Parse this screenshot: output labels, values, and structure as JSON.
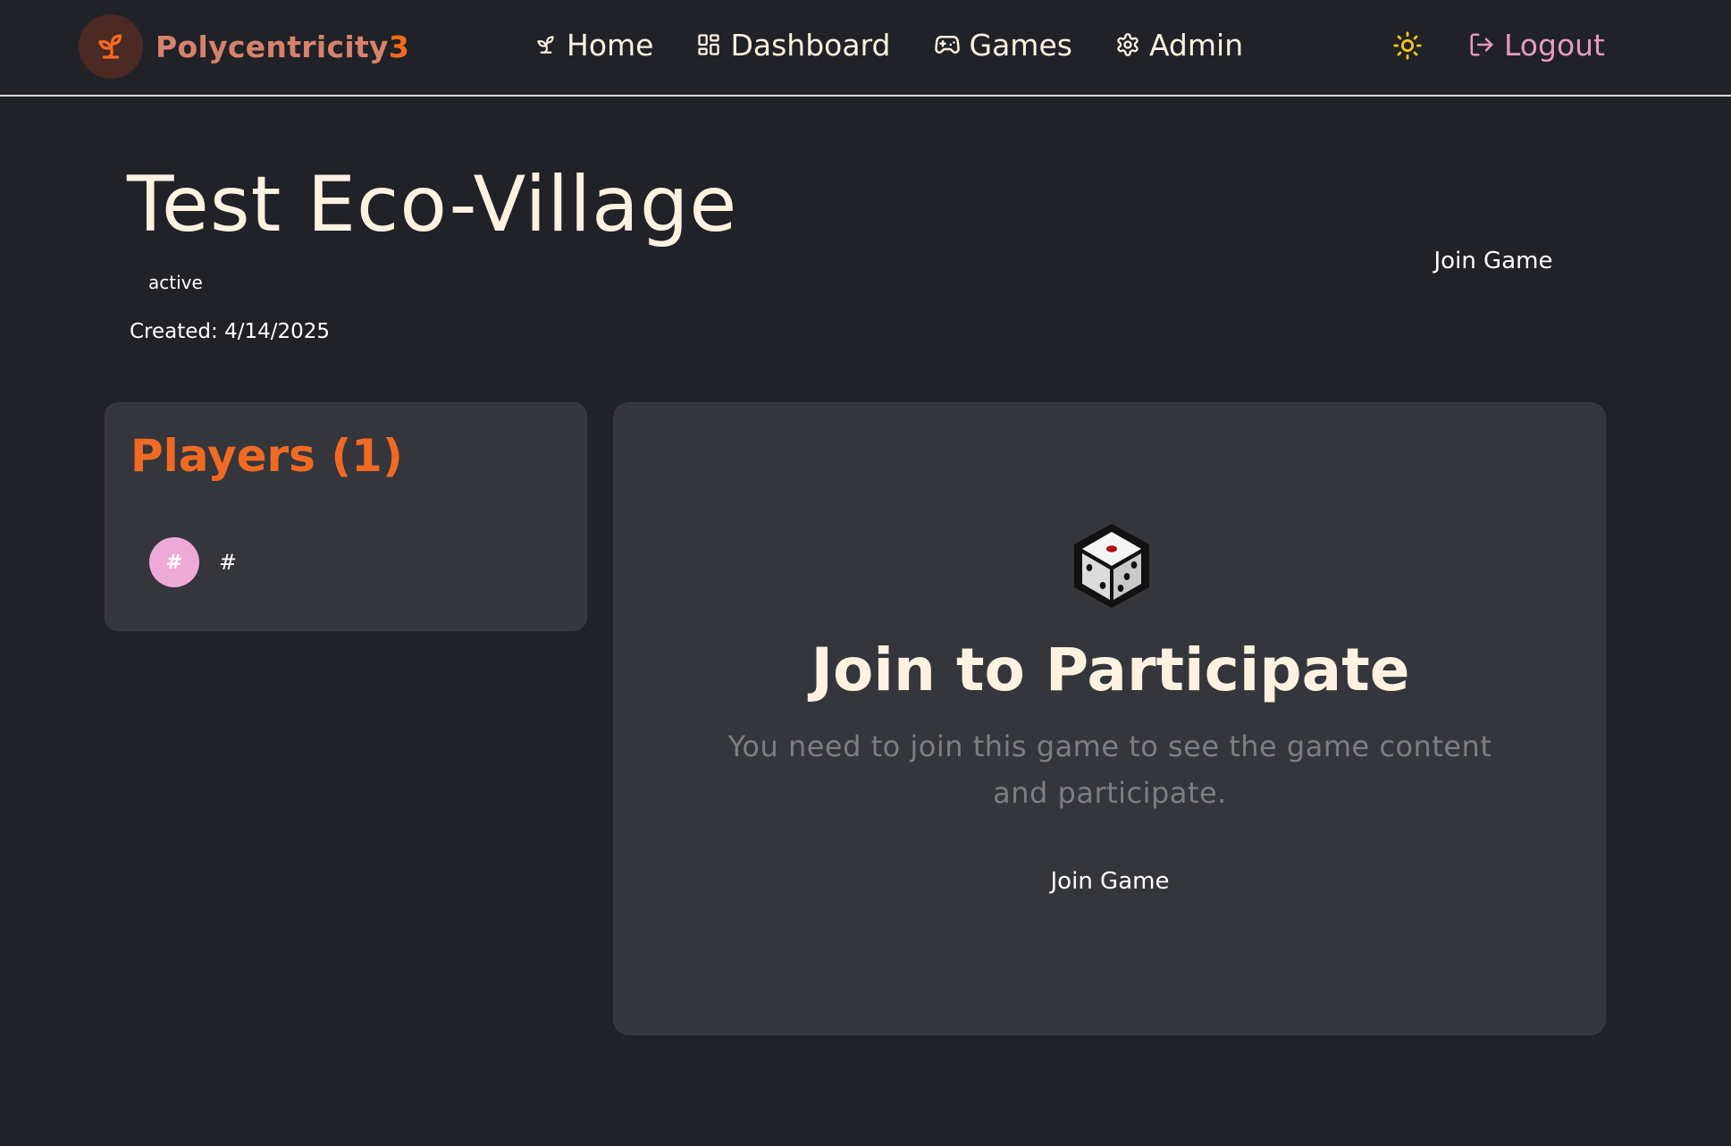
{
  "nav": {
    "brand_name": "Polycentricity",
    "brand_suffix": "3",
    "links": [
      {
        "label": "Home",
        "icon": "sprout-icon"
      },
      {
        "label": "Dashboard",
        "icon": "grid-icon"
      },
      {
        "label": "Games",
        "icon": "gamepad-icon"
      },
      {
        "label": "Admin",
        "icon": "gear-icon"
      }
    ],
    "theme_icon": "sun-icon",
    "logout_label": "Logout"
  },
  "game": {
    "title": "Test Eco-Village",
    "status": "active",
    "created": "Created: 4/14/2025",
    "join_label": "Join Game"
  },
  "players": {
    "title": "Players (1)",
    "list": [
      {
        "avatar": "#",
        "name": "#"
      }
    ]
  },
  "participate": {
    "icon": "dice-icon",
    "title": "Join to Participate",
    "description": "You need to join this game to see the game content and participate.",
    "join_label": "Join Game"
  },
  "colors": {
    "background": "#212228",
    "card": "#34363c",
    "accent": "#f06a24",
    "brand": "#d6826d",
    "logout": "#e59ac1",
    "avatar": "#eeaad6",
    "sun": "#f5c518",
    "text": "#fdf1e0",
    "muted": "#7d7e83"
  }
}
